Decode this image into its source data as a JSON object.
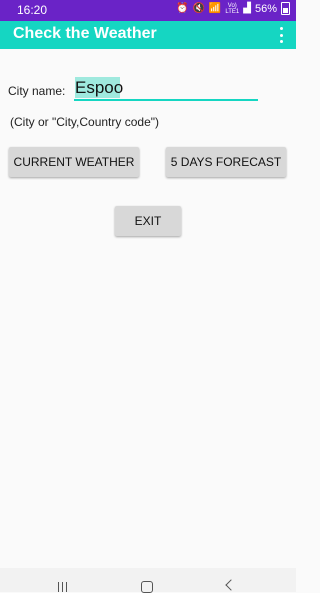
{
  "status_bar": {
    "time": "16:20",
    "battery": "56%",
    "network_label_top": "Vo)",
    "network_label_bottom": "LTE1",
    "icons": [
      "alarm-icon",
      "mute-icon",
      "wifi-icon",
      "signal-icon",
      "battery-icon"
    ]
  },
  "app_bar": {
    "title": "Check the Weather",
    "menu_icon": "overflow-menu-icon",
    "color": "#15d6c2"
  },
  "form": {
    "city_label": "City name:",
    "city_value": "Espoo",
    "hint": "(City or \"City,Country code\")"
  },
  "buttons": {
    "current_weather": "CURRENT WEATHER",
    "forecast": "5 DAYS FORECAST",
    "exit": "EXIT"
  },
  "nav_bar": {
    "icons": [
      "recent-apps-icon",
      "home-icon",
      "back-icon"
    ]
  },
  "colors": {
    "status_bar": "#6a23c7",
    "accent": "#15d6c2",
    "button": "#d8d8d8"
  }
}
